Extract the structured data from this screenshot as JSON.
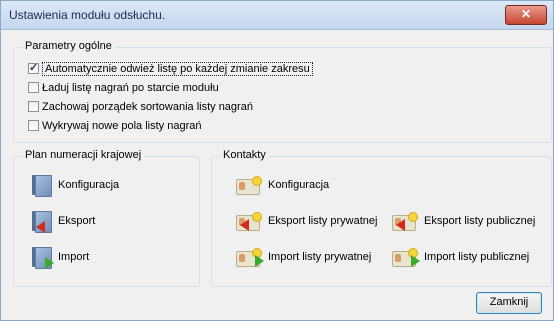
{
  "window": {
    "title": "Ustawienia modułu odsłuchu."
  },
  "general": {
    "legend": "Parametry ogólne",
    "options": [
      {
        "label": "Automatycznie odwież listę po każdej zmianie zakresu",
        "checked": true
      },
      {
        "label": "Ładuj listę nagrań po starcie modułu",
        "checked": false
      },
      {
        "label": "Zachowaj porządek sortowania listy nagrań",
        "checked": false
      },
      {
        "label": "Wykrywaj nowe pola listy nagrań",
        "checked": false
      }
    ]
  },
  "numbering": {
    "legend": "Plan numeracji krajowej",
    "config": "Konfiguracja",
    "export": "Eksport",
    "import": "Import"
  },
  "contacts": {
    "legend": "Kontakty",
    "config": "Konfiguracja",
    "export_private": "Eksport listy prywatnej",
    "export_public": "Eksport listy publicznej",
    "import_private": "Import listy prywatnej",
    "import_public": "Import listy publicznej"
  },
  "footer": {
    "close": "Zamknij"
  }
}
